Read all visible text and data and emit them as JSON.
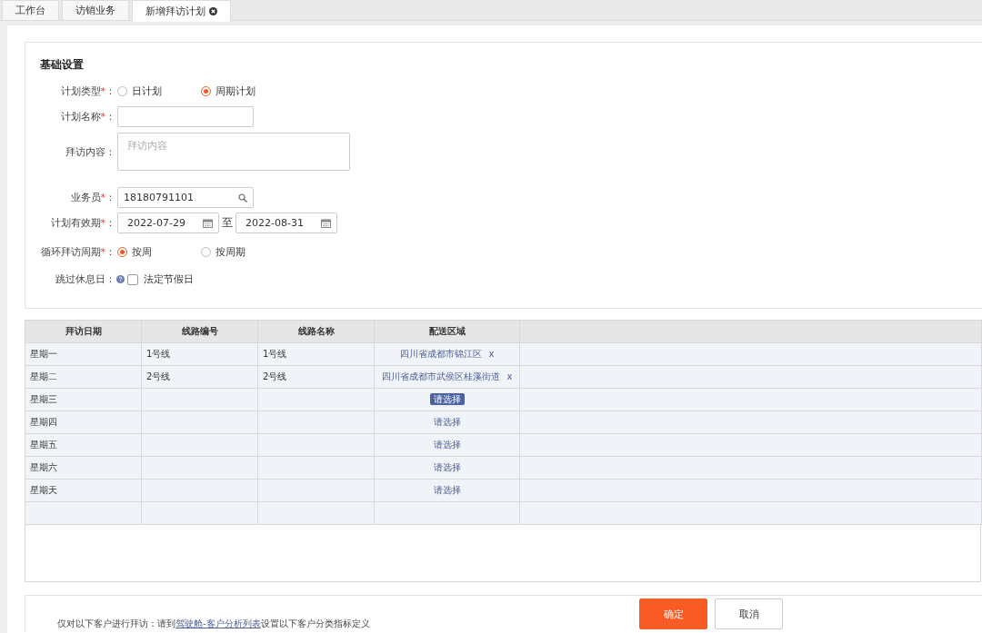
{
  "tabs": [
    {
      "label": "工作台",
      "selected": false,
      "closable": false
    },
    {
      "label": "访销业务",
      "selected": false,
      "closable": false
    },
    {
      "label": "新增拜访计划",
      "selected": true,
      "closable": true
    }
  ],
  "basic_settings": {
    "title": "基础设置",
    "plan_type": {
      "label": "计划类型",
      "mark": "*",
      "colon": "：",
      "options": [
        {
          "label": "日计划",
          "selected": false
        },
        {
          "label": "周期计划",
          "selected": true
        }
      ]
    },
    "plan_name": {
      "label": "计划名称",
      "mark": "*",
      "colon": "："
    },
    "visit_content": {
      "label": "拜访内容",
      "colon": "：",
      "placeholder": "拜访内容"
    },
    "salesperson": {
      "label": "业务员",
      "mark": "*",
      "colon": "：",
      "value": "18180791101"
    },
    "validity": {
      "label": "计划有效期",
      "mark": "*",
      "colon": "：",
      "start": "2022-07-29",
      "separator": "至",
      "end": "2022-08-31"
    },
    "cycle": {
      "label": "循环拜访周期",
      "mark": "*",
      "colon": "：",
      "options": [
        {
          "label": "按周",
          "selected": true
        },
        {
          "label": "按周期",
          "selected": false
        }
      ]
    },
    "skip_rest": {
      "label": "跳过休息日",
      "colon": "：",
      "option": {
        "label": "法定节假日",
        "checked": false
      }
    }
  },
  "table": {
    "columns": [
      "拜访日期",
      "线路编号",
      "线路名称",
      "配送区域"
    ],
    "rows": [
      {
        "day": "星期一",
        "route_no": "1号线",
        "route_name": "1号线",
        "area": {
          "kind": "region",
          "text": "四川省成都市锦江区",
          "remove": "x"
        }
      },
      {
        "day": "星期二",
        "route_no": "2号线",
        "route_name": "2号线",
        "area": {
          "kind": "region",
          "text": "四川省成都市武侯区桂溪街道",
          "remove": "x"
        }
      },
      {
        "day": "星期三",
        "area": {
          "kind": "picker",
          "text": "请选择",
          "selected": true
        }
      },
      {
        "day": "星期四",
        "area": {
          "kind": "picker",
          "text": "请选择",
          "selected": false
        }
      },
      {
        "day": "星期五",
        "area": {
          "kind": "picker",
          "text": "请选择",
          "selected": false
        }
      },
      {
        "day": "星期六",
        "area": {
          "kind": "picker",
          "text": "请选择",
          "selected": false
        }
      },
      {
        "day": "星期天",
        "area": {
          "kind": "picker",
          "text": "请选择",
          "selected": false
        }
      },
      {}
    ]
  },
  "footer": {
    "note": {
      "before": "仅对以下客户进行拜访：请到",
      "link": "驾驶舱-客户分析列表",
      "after": "设置以下客户分类指标定义"
    },
    "buttons": [
      {
        "label": "确定",
        "kind": "primary"
      },
      {
        "label": "取消",
        "kind": "default"
      }
    ]
  }
}
